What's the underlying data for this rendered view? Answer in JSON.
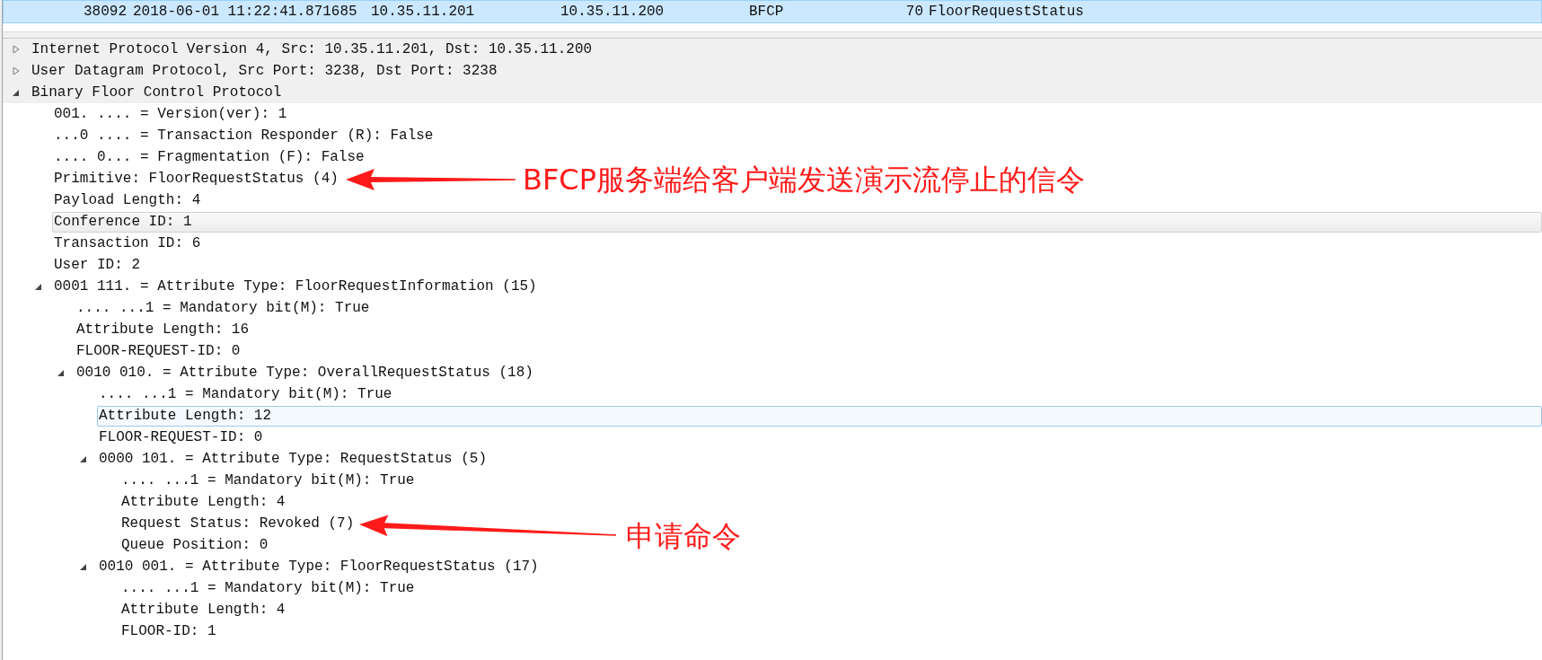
{
  "packet_list": {
    "rows": [
      {
        "no": "38092",
        "time": "2018-06-01 11:22:41.871685",
        "source": "10.35.11.201",
        "destination": "10.35.11.200",
        "protocol": "BFCP",
        "length": "70",
        "info": "FloorRequestStatus",
        "selected": true
      }
    ]
  },
  "details": [
    {
      "text": "Internet Protocol Version 4, Src: 10.35.11.201, Dst: 10.35.11.200",
      "expanded": false,
      "selected": false,
      "hovered": false
    },
    {
      "text": "User Datagram Protocol, Src Port: 3238, Dst Port: 3238",
      "expanded": false,
      "selected": false,
      "hovered": false
    },
    {
      "text": "Binary Floor Control Protocol",
      "expanded": true,
      "selected": false,
      "hovered": false,
      "children": [
        {
          "text": "001. .... = Version(ver): 1",
          "selected": false,
          "hovered": false
        },
        {
          "text": "...0 .... = Transaction Responder (R): False",
          "selected": false,
          "hovered": false
        },
        {
          "text": ".... 0... = Fragmentation (F): False",
          "selected": false,
          "hovered": false
        },
        {
          "text": "Primitive: FloorRequestStatus (4)",
          "selected": false,
          "hovered": false
        },
        {
          "text": "Payload Length: 4",
          "selected": false,
          "hovered": false
        },
        {
          "text": "Conference ID: 1",
          "selected": false,
          "hovered": true
        },
        {
          "text": "Transaction ID: 6",
          "selected": false,
          "hovered": false
        },
        {
          "text": "User ID: 2",
          "selected": false,
          "hovered": false
        },
        {
          "text": "0001 111. = Attribute Type: FloorRequestInformation (15)",
          "expanded": true,
          "selected": false,
          "hovered": false,
          "children": [
            {
              "text": ".... ...1 = Mandatory bit(M): True",
              "selected": false,
              "hovered": false
            },
            {
              "text": "Attribute Length: 16",
              "selected": false,
              "hovered": false
            },
            {
              "text": "FLOOR-REQUEST-ID: 0",
              "selected": false,
              "hovered": false
            },
            {
              "text": "0010 010. = Attribute Type: OverallRequestStatus (18)",
              "expanded": true,
              "selected": false,
              "hovered": false,
              "children": [
                {
                  "text": ".... ...1 = Mandatory bit(M): True",
                  "selected": false,
                  "hovered": false
                },
                {
                  "text": "Attribute Length: 12",
                  "selected": true,
                  "hovered": false
                },
                {
                  "text": "FLOOR-REQUEST-ID: 0",
                  "selected": false,
                  "hovered": false
                },
                {
                  "text": "0000 101. = Attribute Type: RequestStatus (5)",
                  "expanded": true,
                  "selected": false,
                  "hovered": false,
                  "children": [
                    {
                      "text": ".... ...1 = Mandatory bit(M): True",
                      "selected": false,
                      "hovered": false
                    },
                    {
                      "text": "Attribute Length: 4",
                      "selected": false,
                      "hovered": false
                    },
                    {
                      "text": "Request Status: Revoked (7)",
                      "selected": false,
                      "hovered": false
                    },
                    {
                      "text": "Queue Position: 0",
                      "selected": false,
                      "hovered": false
                    }
                  ]
                },
                {
                  "text": "0010 001. = Attribute Type: FloorRequestStatus (17)",
                  "expanded": true,
                  "selected": false,
                  "hovered": false,
                  "children": [
                    {
                      "text": ".... ...1 = Mandatory bit(M): True",
                      "selected": false,
                      "hovered": false
                    },
                    {
                      "text": "Attribute Length: 4",
                      "selected": false,
                      "hovered": false
                    },
                    {
                      "text": "FLOOR-ID: 1",
                      "selected": false,
                      "hovered": false
                    }
                  ]
                }
              ]
            }
          ]
        }
      ]
    }
  ],
  "annotations": [
    {
      "text": "BFCP服务端给客户端发送演示流停止的信令"
    },
    {
      "text": "申请命令"
    }
  ]
}
